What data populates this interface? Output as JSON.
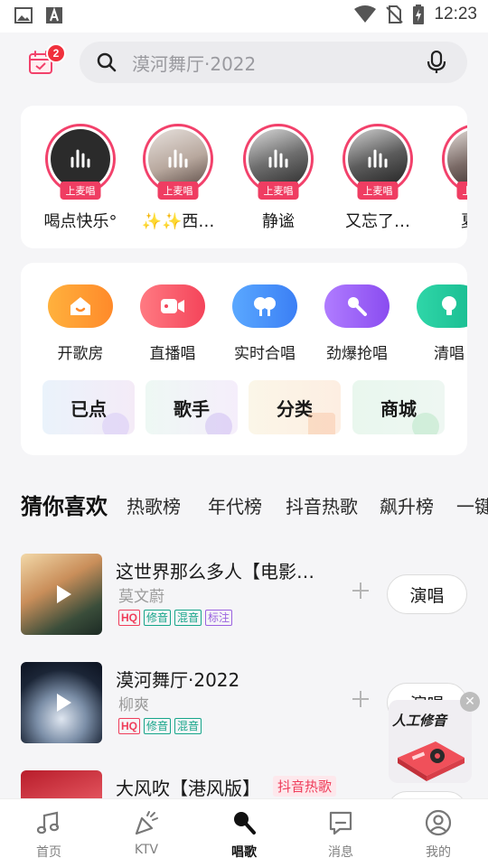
{
  "status_bar": {
    "time": "12:23"
  },
  "header": {
    "notification_count": "2",
    "search_placeholder": "漠河舞厅·2022"
  },
  "live_singers": {
    "badge_label": "上麦唱",
    "items": [
      {
        "name": "喝点快乐°"
      },
      {
        "name": "✨✨西…"
      },
      {
        "name": "静谧"
      },
      {
        "name": "又忘了…"
      },
      {
        "name": "夏乔"
      }
    ]
  },
  "features": [
    {
      "label": "开歌房",
      "icon": "house-icon"
    },
    {
      "label": "直播唱",
      "icon": "video-camera-icon"
    },
    {
      "label": "实时合唱",
      "icon": "chorus-icon"
    },
    {
      "label": "劲爆抢唱",
      "icon": "microphone-icon"
    },
    {
      "label": "清唱",
      "icon": "lightbulb-icon"
    }
  ],
  "shortcuts": [
    "已点",
    "歌手",
    "分类",
    "商城"
  ],
  "tabs": [
    "猜你喜欢",
    "热歌榜",
    "年代榜",
    "抖音热歌",
    "飙升榜",
    "一键"
  ],
  "songs": [
    {
      "title": "这世界那么多人【电影…",
      "artist": "莫文蔚",
      "tags": [
        "HQ",
        "修音",
        "混音",
        "标注"
      ],
      "button": "演唱"
    },
    {
      "title": "漠河舞厅·2022",
      "artist": "柳爽",
      "tags": [
        "HQ",
        "修音",
        "混音"
      ],
      "button": "演唱"
    },
    {
      "title": "大风吹【港风版】",
      "artist": "",
      "hot_tag": "抖音热歌",
      "button": "演唱"
    }
  ],
  "floating_ad": {
    "title": "人工修音"
  },
  "bottom_nav": [
    {
      "label": "首页",
      "icon": "music-note-icon"
    },
    {
      "label": "KTV",
      "icon": "party-popper-icon"
    },
    {
      "label": "唱歌",
      "icon": "microphone-icon",
      "active": true
    },
    {
      "label": "消息",
      "icon": "message-icon"
    },
    {
      "label": "我的",
      "icon": "profile-icon"
    }
  ]
}
